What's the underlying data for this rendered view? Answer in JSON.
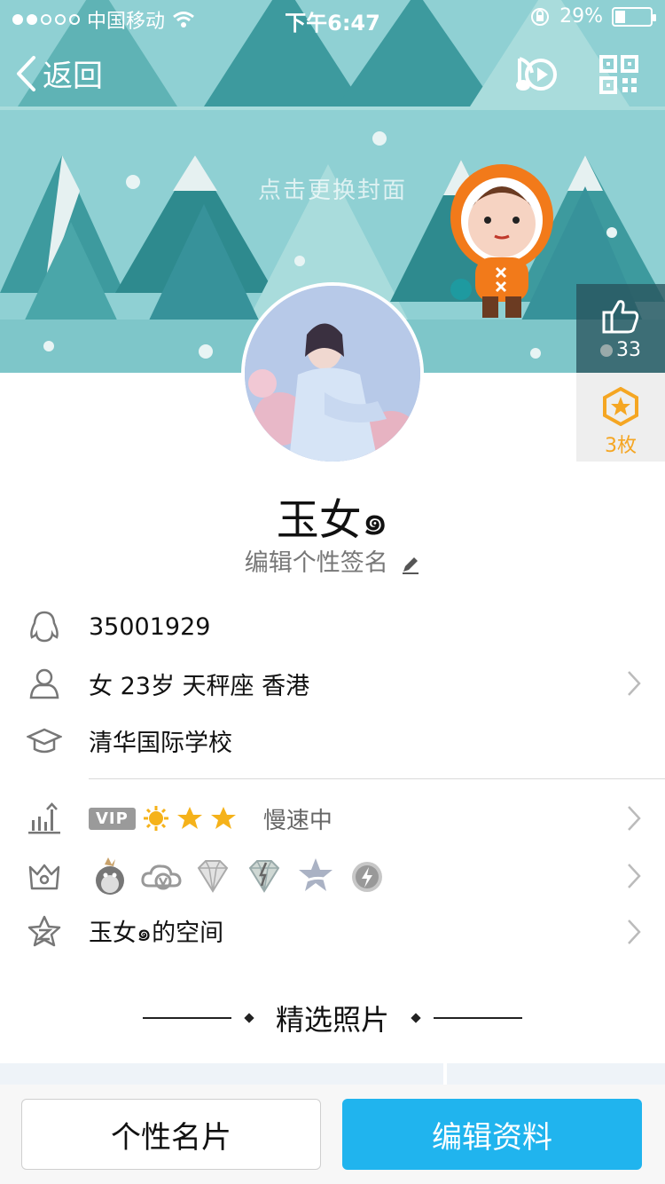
{
  "status_bar": {
    "carrier": "中国移动",
    "time": "下午6:47",
    "battery": "29%",
    "battery_level": 0.29
  },
  "nav": {
    "back_label": "返回"
  },
  "cover": {
    "hint": "点击更换封面"
  },
  "likes": {
    "count": "33"
  },
  "medals": {
    "count": "3枚",
    "color": "#f5a623"
  },
  "profile": {
    "name": "玉女๑",
    "signature": "编辑个性签名"
  },
  "info": {
    "qq_number": "35001929",
    "personal": "女 23岁 天秤座 香港",
    "school": "清华国际学校",
    "vip_label": "VIP",
    "speed_status": "慢速中",
    "space": "玉女๑的空间"
  },
  "section": {
    "title": "精选照片"
  },
  "buttons": {
    "card": "个性名片",
    "edit": "编辑资料"
  },
  "colors": {
    "accent": "#20b4ee",
    "cover_bg": "#8fd0d3"
  },
  "icons": {
    "qq": "penguin-icon",
    "person": "person-icon",
    "school": "graduation-cap-icon",
    "level": "level-chart-icon",
    "crown": "crown-icon",
    "space": "qzone-icon"
  }
}
